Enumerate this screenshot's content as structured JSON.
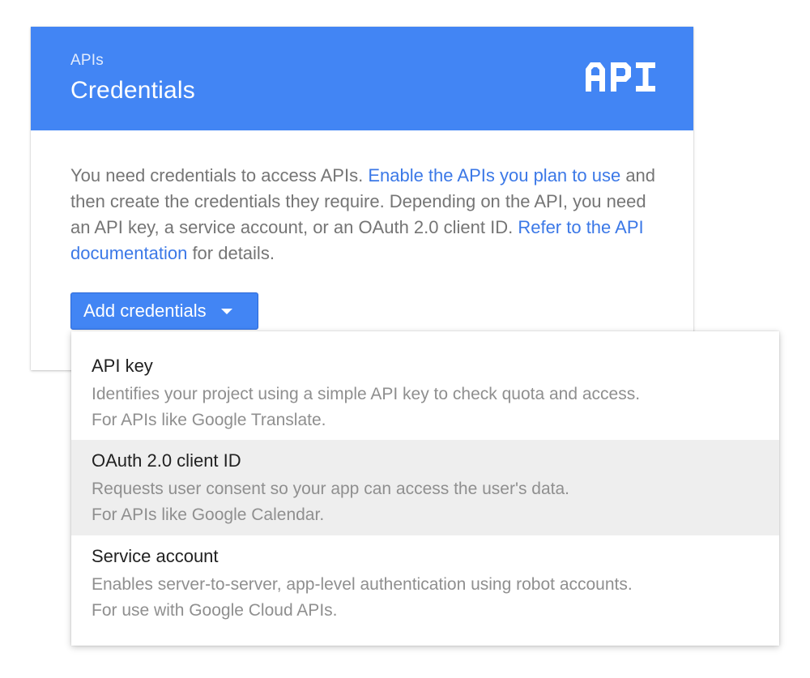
{
  "header": {
    "subtitle": "APIs",
    "title": "Credentials",
    "logo_text": "API"
  },
  "body": {
    "text_1": "You need credentials to access APIs. ",
    "link_1": "Enable the APIs you plan to use",
    "text_2": " and then create the credentials they require. Depending on the API, you need an API key, a service account, or an OAuth 2.0 client ID. ",
    "link_2": "Refer to the API documentation",
    "text_3": " for details."
  },
  "button": {
    "label": "Add credentials"
  },
  "menu": {
    "items": [
      {
        "title": "API key",
        "desc_1": "Identifies your project using a simple API key to check quota and access.",
        "desc_2": "For APIs like Google Translate."
      },
      {
        "title": "OAuth 2.0 client ID",
        "desc_1": "Requests user consent so your app can access the user's data.",
        "desc_2": "For APIs like Google Calendar."
      },
      {
        "title": "Service account",
        "desc_1": "Enables server-to-server, app-level authentication using robot accounts.",
        "desc_2": "For use with Google Cloud APIs."
      }
    ],
    "highlighted_index": 1
  },
  "colors": {
    "header_bg": "#4285f4",
    "link": "#3b78e7",
    "button_bg": "#4285f4",
    "highlight_bg": "#eeeeee"
  }
}
